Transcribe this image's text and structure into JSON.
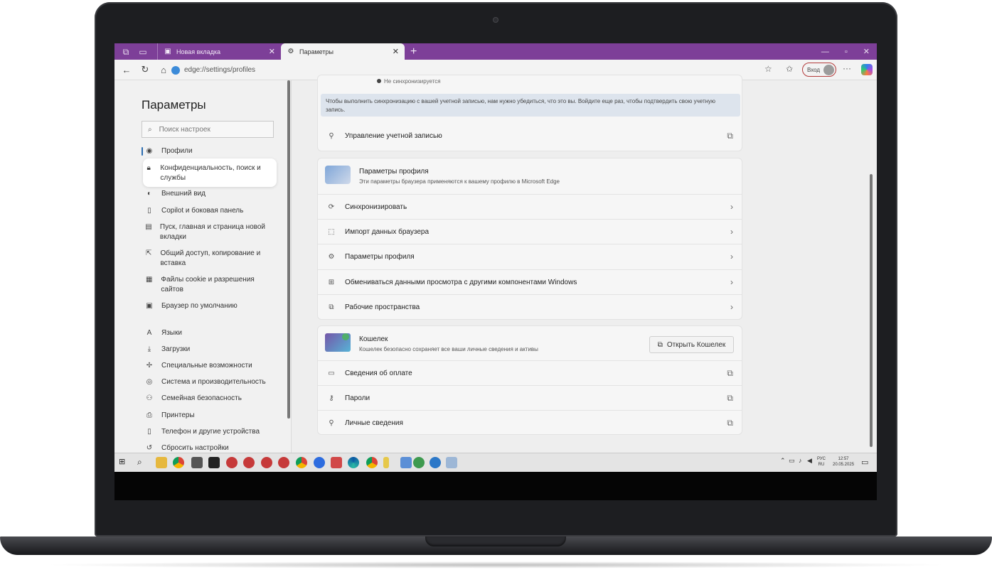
{
  "browser": {
    "tabs": [
      {
        "label": "Новая вкладка",
        "icon": "new-tab-icon"
      },
      {
        "label": "Параметры",
        "icon": "gear-icon"
      }
    ],
    "address": "edge://settings/profiles",
    "signin_label": "Вход"
  },
  "sidebar": {
    "title": "Параметры",
    "search_placeholder": "Поиск настроек",
    "items": [
      {
        "label": "Профили",
        "icon": "profile-icon"
      },
      {
        "label": "Конфиденциальность, поиск и службы",
        "icon": "lock-icon"
      },
      {
        "label": "Внешний вид",
        "icon": "appearance-icon"
      },
      {
        "label": "Copilot и боковая панель",
        "icon": "sidebar-icon"
      },
      {
        "label": "Пуск, главная и страница новой вкладки",
        "icon": "home-page-icon"
      },
      {
        "label": "Общий доступ, копирование и вставка",
        "icon": "share-icon"
      },
      {
        "label": "Файлы cookie и разрешения сайтов",
        "icon": "cookie-icon"
      },
      {
        "label": "Браузер по умолчанию",
        "icon": "default-browser-icon"
      },
      {
        "label": "Языки",
        "icon": "languages-icon"
      },
      {
        "label": "Загрузки",
        "icon": "download-icon"
      },
      {
        "label": "Специальные возможности",
        "icon": "accessibility-icon"
      },
      {
        "label": "Система и производительность",
        "icon": "system-icon"
      },
      {
        "label": "Семейная безопасность",
        "icon": "family-icon"
      },
      {
        "label": "Принтеры",
        "icon": "printer-icon"
      },
      {
        "label": "Телефон и другие устройства",
        "icon": "phone-icon"
      },
      {
        "label": "Сбросить настройки",
        "icon": "reset-icon"
      }
    ]
  },
  "account": {
    "status": "Не синхронизируется",
    "banner": "Чтобы выполнить синхронизацию с вашей учетной записью, нам нужно убедиться, что это вы. Войдите еще раз, чтобы подтвердить свою учетную запись.",
    "manage": "Управление учетной записью"
  },
  "profile_settings": {
    "title": "Параметры профиля",
    "subtitle": "Эти параметры браузера применяются к вашему профилю в Microsoft Edge",
    "rows": [
      {
        "label": "Синхронизировать",
        "icon": "sync-icon"
      },
      {
        "label": "Импорт данных браузера",
        "icon": "import-icon"
      },
      {
        "label": "Параметры профиля",
        "icon": "profile-settings-icon"
      },
      {
        "label": "Обмениваться данными просмотра с другими компонентами Windows",
        "icon": "windows-icon"
      },
      {
        "label": "Рабочие пространства",
        "icon": "workspaces-icon"
      }
    ]
  },
  "wallet": {
    "title": "Кошелек",
    "subtitle": "Кошелек безопасно сохраняет все ваши личные сведения и активы",
    "open_button": "Открыть Кошелек",
    "rows": [
      {
        "label": "Сведения об оплате",
        "icon": "card-icon"
      },
      {
        "label": "Пароли",
        "icon": "key-icon"
      },
      {
        "label": "Личные сведения",
        "icon": "personal-info-icon"
      }
    ]
  },
  "taskbar": {
    "lang_top": "РУС",
    "lang_bottom": "RU",
    "time": "12:57",
    "date": "20.05.2025"
  }
}
